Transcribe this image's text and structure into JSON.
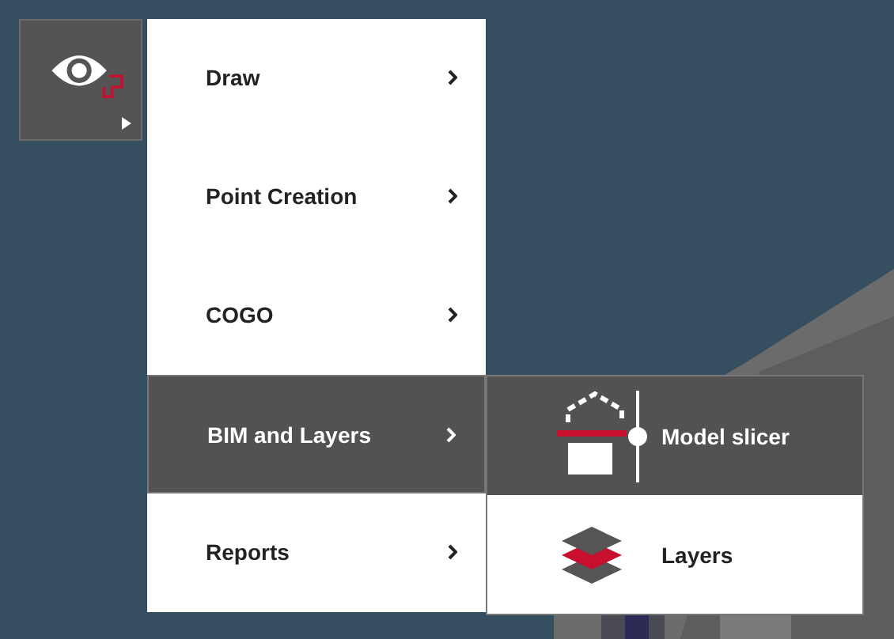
{
  "menu": {
    "items": [
      {
        "label": "Draw",
        "selected": false
      },
      {
        "label": "Point Creation",
        "selected": false
      },
      {
        "label": "COGO",
        "selected": false
      },
      {
        "label": "BIM and Layers",
        "selected": true
      },
      {
        "label": "Reports",
        "selected": false
      }
    ]
  },
  "submenu": {
    "items": [
      {
        "label": "Model slicer",
        "kind": "slicer",
        "selected": true
      },
      {
        "label": "Layers",
        "kind": "layers",
        "selected": false
      }
    ]
  }
}
